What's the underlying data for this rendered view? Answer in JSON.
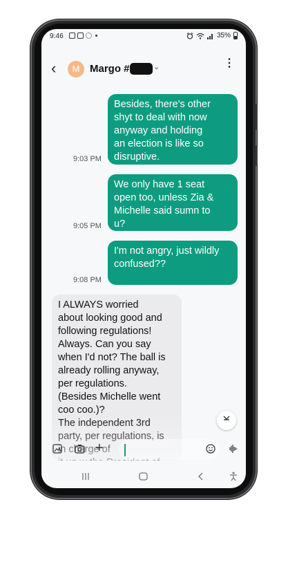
{
  "status_bar": {
    "time": "9:46",
    "battery": "35%"
  },
  "header": {
    "contact_initial": "M",
    "contact_name": "Margo #",
    "back_icon": "chevron-left-icon",
    "more_icon": "more-vert-icon"
  },
  "messages": [
    {
      "type": "sent",
      "text": "Besides, there's other\nshyt to deal with now\nanyway and holding\nan election is like so\ndisruptive.",
      "time": "9:03 PM"
    },
    {
      "type": "sent",
      "text": "We only have 1 seat\nopen too, unless Zia &\nMichelle said sumn to\nu?",
      "time": "9:05 PM"
    },
    {
      "type": "sent",
      "text": "I'm not angry, just wildly\nconfused??",
      "time": "9:08 PM"
    },
    {
      "type": "received",
      "text": "I ALWAYS worried\nabout looking good and\nfollowing regulations!\nAlways. Can you say\nwhen I'd not? The ball is\nalready rolling anyway,\nper regulations.\n(Besides Michelle went\ncoo coo.)?\nThe independent 3rd\nparty, per regulations, is\nin charge of\nit up w the President of"
    }
  ],
  "input_bar": {
    "icons": [
      "gallery-icon",
      "camera-icon",
      "plus-icon",
      "emoji-icon",
      "voice-icon"
    ]
  },
  "nav_bar": {
    "icons": [
      "recents-icon",
      "home-icon",
      "back-icon",
      "accessibility-icon"
    ]
  },
  "colors": {
    "sent_bubble": "#0e9c80",
    "received_bubble": "#ebebed",
    "avatar": "#f4b98a"
  }
}
